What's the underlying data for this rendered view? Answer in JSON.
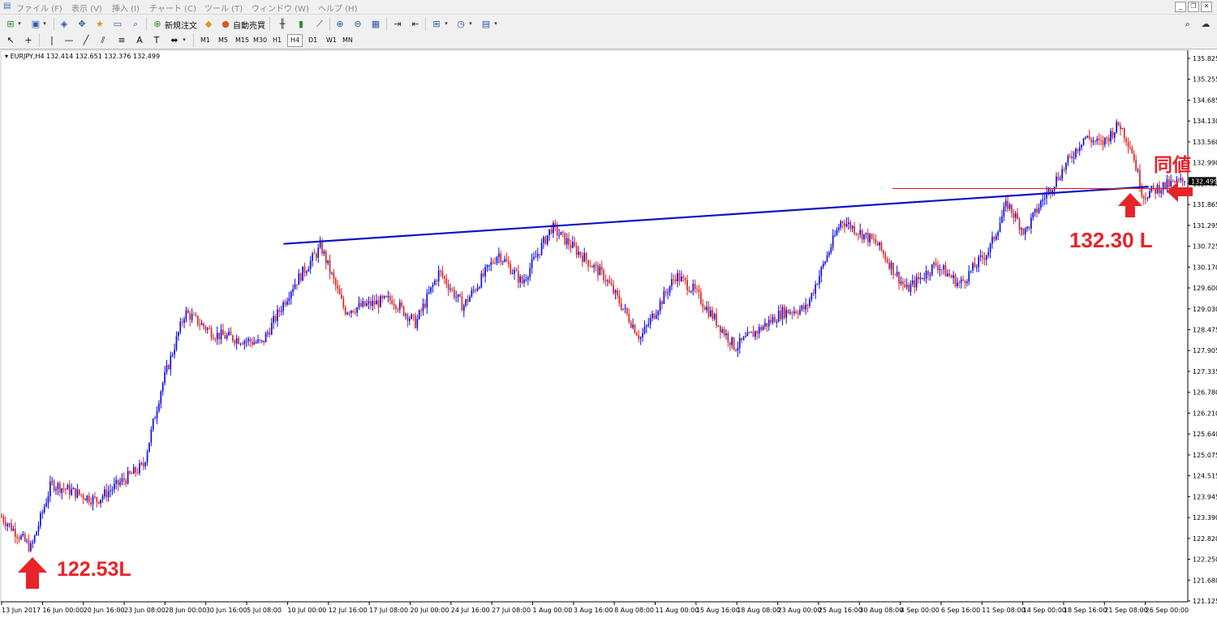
{
  "menu": {
    "items": [
      "ファイル (F)",
      "表示 (V)",
      "挿入 (I)",
      "チャート (C)",
      "ツール (T)",
      "ウィンドウ (W)",
      "ヘルプ (H)"
    ]
  },
  "toolbar": {
    "new_order_label": "新規注文",
    "auto_trade_label": "自動売買",
    "timeframes": [
      "M1",
      "M5",
      "M15",
      "M30",
      "H1",
      "H4",
      "D1",
      "W1",
      "MN"
    ],
    "active_timeframe": "H4"
  },
  "chart_title": "EURJPY,H4  132.414 132.651 132.376 132.499",
  "annotations": {
    "low_label": "122.53L",
    "support_label": "132.30 L",
    "same_price_label": "同値"
  },
  "colors": {
    "bull": "#0a0ae6",
    "bear": "#e0211c",
    "trendline": "#1010c8",
    "support_line": "#e0211c",
    "annotation": "#e8232a"
  },
  "chart_data": {
    "type": "candlestick",
    "symbol": "EURJPY",
    "timeframe": "H4",
    "ohlc_display": {
      "open": 132.414,
      "high": 132.651,
      "low": 132.376,
      "close": 132.499
    },
    "current_price_label": "132.499",
    "y_ticks": [
      "135.825",
      "135.255",
      "134.685",
      "134.130",
      "133.560",
      "132.990",
      "132.430",
      "131.865",
      "131.295",
      "130.725",
      "130.170",
      "129.600",
      "129.030",
      "128.475",
      "127.905",
      "127.335",
      "126.780",
      "126.210",
      "125.640",
      "125.075",
      "124.515",
      "123.945",
      "123.390",
      "122.820",
      "122.250",
      "121.680",
      "121.125"
    ],
    "ylim": [
      121.125,
      135.825
    ],
    "x_ticks": [
      "13 Jun 2017",
      "16 Jun 00:00",
      "20 Jun 16:00",
      "23 Jun 08:00",
      "28 Jun 00:00",
      "30 Jun 16:00",
      "5 Jul 08:00",
      "10 Jul 00:00",
      "12 Jul 16:00",
      "17 Jul 08:00",
      "20 Jul 00:00",
      "24 Jul 16:00",
      "27 Jul 08:00",
      "1 Aug 00:00",
      "3 Aug 16:00",
      "8 Aug 08:00",
      "11 Aug 00:00",
      "15 Aug 16:00",
      "18 Aug 08:00",
      "23 Aug 00:00",
      "25 Aug 16:00",
      "30 Aug 08:00",
      "4 Sep 00:00",
      "6 Sep 16:00",
      "11 Sep 08:00",
      "14 Sep 00:00",
      "18 Sep 16:00",
      "21 Sep 08:00",
      "26 Sep 00:00"
    ],
    "price_path": [
      [
        0,
        123.4
      ],
      [
        0.025,
        122.55
      ],
      [
        0.042,
        124.3
      ],
      [
        0.08,
        123.85
      ],
      [
        0.12,
        124.8
      ],
      [
        0.135,
        126.9
      ],
      [
        0.155,
        128.95
      ],
      [
        0.18,
        128.35
      ],
      [
        0.22,
        128.1
      ],
      [
        0.245,
        129.6
      ],
      [
        0.27,
        130.72
      ],
      [
        0.29,
        129.0
      ],
      [
        0.33,
        129.3
      ],
      [
        0.35,
        128.65
      ],
      [
        0.37,
        130.05
      ],
      [
        0.39,
        129.1
      ],
      [
        0.42,
        130.55
      ],
      [
        0.44,
        129.75
      ],
      [
        0.465,
        131.25
      ],
      [
        0.49,
        130.5
      ],
      [
        0.51,
        129.9
      ],
      [
        0.54,
        128.25
      ],
      [
        0.57,
        129.95
      ],
      [
        0.585,
        129.55
      ],
      [
        0.62,
        128.0
      ],
      [
        0.66,
        128.95
      ],
      [
        0.68,
        129.05
      ],
      [
        0.71,
        131.45
      ],
      [
        0.74,
        130.8
      ],
      [
        0.765,
        129.55
      ],
      [
        0.79,
        130.25
      ],
      [
        0.81,
        129.7
      ],
      [
        0.835,
        130.65
      ],
      [
        0.85,
        131.9
      ],
      [
        0.865,
        131.1
      ],
      [
        0.88,
        132.0
      ],
      [
        0.9,
        132.95
      ],
      [
        0.915,
        133.7
      ],
      [
        0.93,
        133.5
      ],
      [
        0.945,
        134.05
      ],
      [
        0.955,
        133.4
      ],
      [
        0.965,
        132.1
      ],
      [
        0.98,
        132.35
      ],
      [
        1,
        132.5
      ]
    ],
    "lines": [
      {
        "kind": "trendline",
        "from": [
          "10 Jul 00:00",
          130.8
        ],
        "to": [
          "26 Sep 00:00",
          132.35
        ]
      },
      {
        "kind": "horizontal",
        "price": 132.3
      }
    ]
  }
}
